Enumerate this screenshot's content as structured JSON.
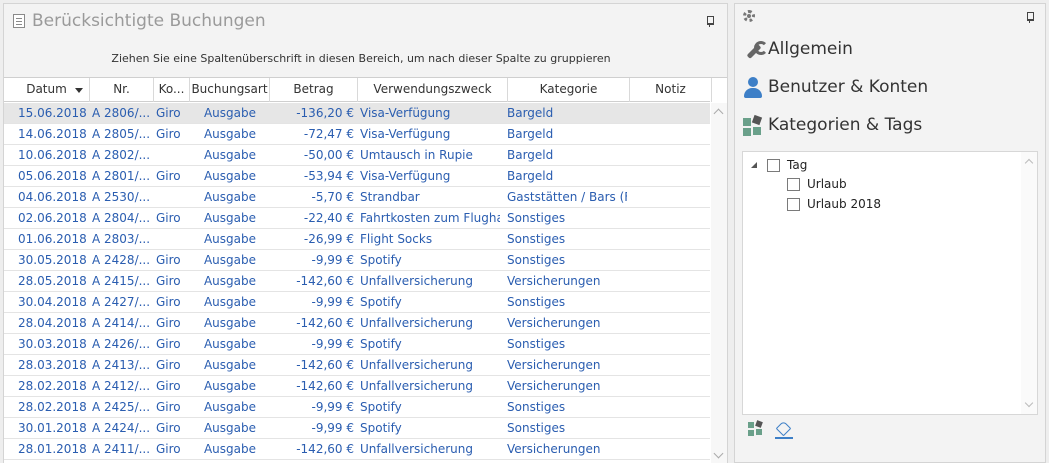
{
  "left_panel": {
    "title": "Berücksichtigte Buchungen",
    "group_hint": "Ziehen Sie eine Spaltenüberschrift in diesen Bereich, um nach dieser Spalte zu gruppieren",
    "columns": [
      "Datum",
      "Nr.",
      "Ko...",
      "Buchungsart",
      "Betrag",
      "Verwendungszweck",
      "Kategorie",
      "Notiz"
    ],
    "rows": [
      {
        "datum": "15.06.2018",
        "nr": "A 2806/...",
        "konto": "Giro",
        "art": "Ausgabe",
        "betrag": "-136,20 €",
        "zweck": "Visa-Verfügung",
        "kategorie": "Bargeld",
        "notiz": ""
      },
      {
        "datum": "14.06.2018",
        "nr": "A 2805/...",
        "konto": "Giro",
        "art": "Ausgabe",
        "betrag": "-72,47 €",
        "zweck": "Visa-Verfügung",
        "kategorie": "Bargeld",
        "notiz": ""
      },
      {
        "datum": "10.06.2018",
        "nr": "A 2802/...",
        "konto": "",
        "art": "Ausgabe",
        "betrag": "-50,00 €",
        "zweck": "Umtausch in Rupie",
        "kategorie": "Bargeld",
        "notiz": ""
      },
      {
        "datum": "05.06.2018",
        "nr": "A 2801/...",
        "konto": "Giro",
        "art": "Ausgabe",
        "betrag": "-53,94 €",
        "zweck": "Visa-Verfügung",
        "kategorie": "Bargeld",
        "notiz": ""
      },
      {
        "datum": "04.06.2018",
        "nr": "A 2530/...",
        "konto": "",
        "art": "Ausgabe",
        "betrag": "-5,70 €",
        "zweck": "Strandbar",
        "kategorie": "Gaststätten / Bars (F...",
        "notiz": ""
      },
      {
        "datum": "02.06.2018",
        "nr": "A 2804/...",
        "konto": "Giro",
        "art": "Ausgabe",
        "betrag": "-22,40 €",
        "zweck": "Fahrtkosten zum Flugha...",
        "kategorie": "Sonstiges",
        "notiz": ""
      },
      {
        "datum": "01.06.2018",
        "nr": "A 2803/...",
        "konto": "",
        "art": "Ausgabe",
        "betrag": "-26,99 €",
        "zweck": "Flight Socks",
        "kategorie": "Sonstiges",
        "notiz": ""
      },
      {
        "datum": "30.05.2018",
        "nr": "A 2428/...",
        "konto": "Giro",
        "art": "Ausgabe",
        "betrag": "-9,99 €",
        "zweck": "Spotify",
        "kategorie": "Sonstiges",
        "notiz": ""
      },
      {
        "datum": "28.05.2018",
        "nr": "A 2415/...",
        "konto": "Giro",
        "art": "Ausgabe",
        "betrag": "-142,60 €",
        "zweck": "Unfallversicherung",
        "kategorie": "Versicherungen",
        "notiz": ""
      },
      {
        "datum": "30.04.2018",
        "nr": "A 2427/...",
        "konto": "Giro",
        "art": "Ausgabe",
        "betrag": "-9,99 €",
        "zweck": "Spotify",
        "kategorie": "Sonstiges",
        "notiz": ""
      },
      {
        "datum": "28.04.2018",
        "nr": "A 2414/...",
        "konto": "Giro",
        "art": "Ausgabe",
        "betrag": "-142,60 €",
        "zweck": "Unfallversicherung",
        "kategorie": "Versicherungen",
        "notiz": ""
      },
      {
        "datum": "30.03.2018",
        "nr": "A 2426/...",
        "konto": "Giro",
        "art": "Ausgabe",
        "betrag": "-9,99 €",
        "zweck": "Spotify",
        "kategorie": "Sonstiges",
        "notiz": ""
      },
      {
        "datum": "28.03.2018",
        "nr": "A 2413/...",
        "konto": "Giro",
        "art": "Ausgabe",
        "betrag": "-142,60 €",
        "zweck": "Unfallversicherung",
        "kategorie": "Versicherungen",
        "notiz": ""
      },
      {
        "datum": "28.02.2018",
        "nr": "A 2412/...",
        "konto": "Giro",
        "art": "Ausgabe",
        "betrag": "-142,60 €",
        "zweck": "Unfallversicherung",
        "kategorie": "Versicherungen",
        "notiz": ""
      },
      {
        "datum": "28.02.2018",
        "nr": "A 2425/...",
        "konto": "Giro",
        "art": "Ausgabe",
        "betrag": "-9,99 €",
        "zweck": "Spotify",
        "kategorie": "Sonstiges",
        "notiz": ""
      },
      {
        "datum": "30.01.2018",
        "nr": "A 2424/...",
        "konto": "Giro",
        "art": "Ausgabe",
        "betrag": "-9,99 €",
        "zweck": "Spotify",
        "kategorie": "Sonstiges",
        "notiz": ""
      },
      {
        "datum": "28.01.2018",
        "nr": "A 2411/...",
        "konto": "Giro",
        "art": "Ausgabe",
        "betrag": "-142,60 €",
        "zweck": "Unfallversicherung",
        "kategorie": "Versicherungen",
        "notiz": ""
      }
    ]
  },
  "right_panel": {
    "nav": [
      {
        "label": "Allgemein",
        "icon": "wrench-icon"
      },
      {
        "label": "Benutzer & Konten",
        "icon": "user-icon"
      },
      {
        "label": "Kategorien & Tags",
        "icon": "categories-icon"
      }
    ],
    "tree": {
      "root": "Tag",
      "children": [
        "Urlaub",
        "Urlaub 2018"
      ]
    }
  },
  "colors": {
    "row_text": "#2a5db0",
    "accent": "#3d7fc7",
    "selected_row": "#e6e6e6"
  }
}
